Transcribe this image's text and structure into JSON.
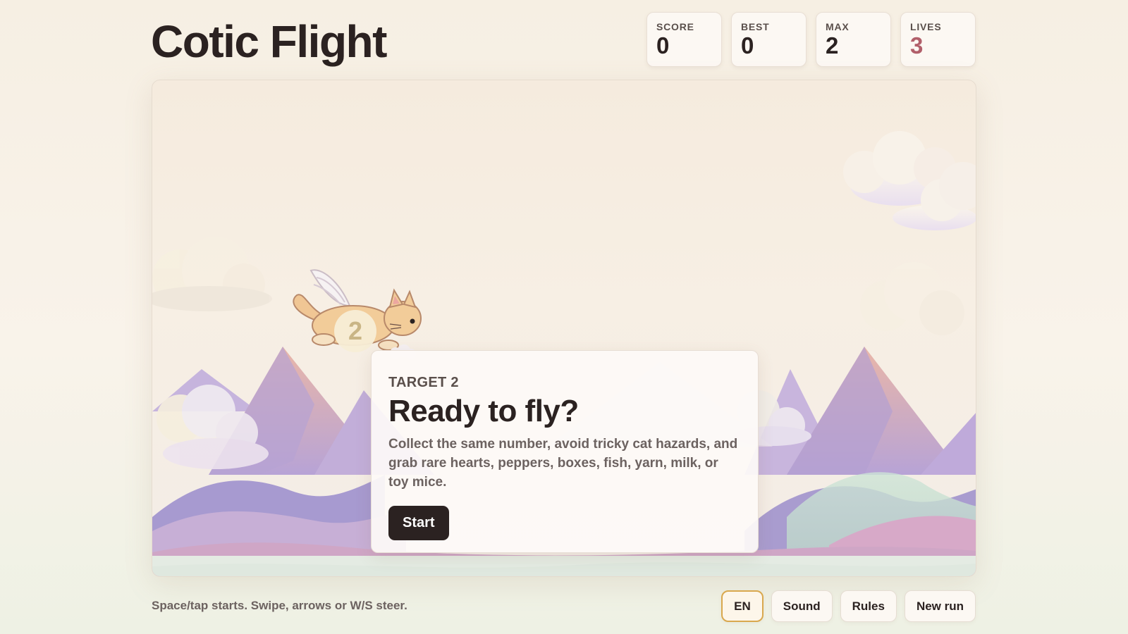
{
  "title": "Cotic Flight",
  "stats": [
    {
      "label": "SCORE",
      "value": "0"
    },
    {
      "label": "BEST",
      "value": "0"
    },
    {
      "label": "MAX",
      "value": "2"
    },
    {
      "label": "LIVES",
      "value": "3"
    }
  ],
  "player": {
    "number": "2"
  },
  "overlay": {
    "kicker": "TARGET 2",
    "heading": "Ready to fly?",
    "text": "Collect the same number, avoid tricky cat hazards, and grab rare hearts, peppers, boxes, fish, yarn, milk, or toy mice.",
    "start_label": "Start"
  },
  "hint": "Space/tap starts. Swipe, arrows or W/S steer.",
  "controls": {
    "language": "EN",
    "sound": "Sound",
    "rules": "Rules",
    "new_run": "New run"
  },
  "colors": {
    "text": "#2b2221",
    "lives": "#b15f6a",
    "button_dark": "#2b2221",
    "active_border": "#d9a84e"
  }
}
